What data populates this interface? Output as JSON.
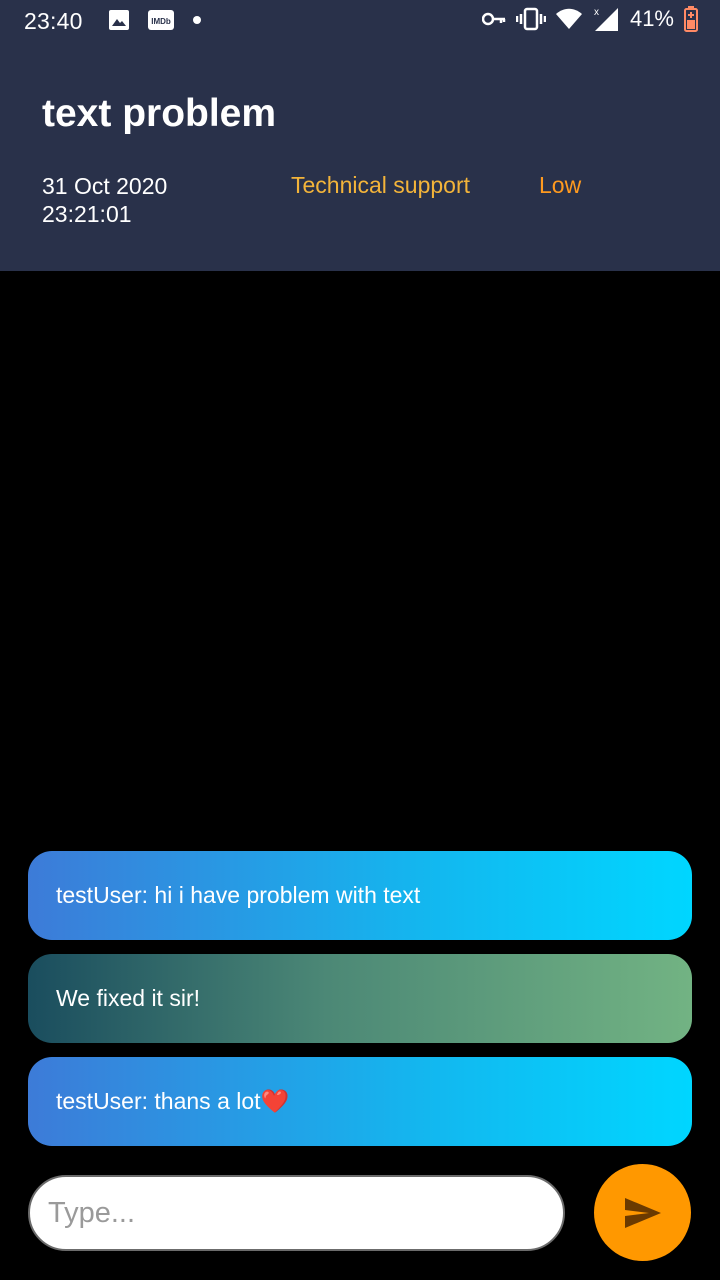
{
  "status_bar": {
    "time": "23:40",
    "left_icons": [
      "image-icon",
      "imdb-icon",
      "dot-icon"
    ],
    "imdb_label": "IMDb",
    "right_icons": [
      "key-icon",
      "vibrate-icon",
      "wifi-icon",
      "signal-icon",
      "battery-icon"
    ],
    "battery_percent": "41%"
  },
  "ticket": {
    "title": "text problem",
    "date": "31 Oct 2020",
    "time": "23:21:01",
    "category": "Technical support",
    "priority": "Low"
  },
  "messages": [
    {
      "sender": "user",
      "text": "testUser: hi i have problem with text"
    },
    {
      "sender": "support",
      "text": "We fixed it sir!"
    },
    {
      "sender": "user",
      "text": "testUser: thans a lot❤️"
    }
  ],
  "composer": {
    "placeholder": "Type...",
    "send_icon": "send-icon"
  },
  "colors": {
    "header_bg": "#29314a",
    "category": "#f3b43a",
    "priority": "#ff9a1f",
    "send_button": "#ff9800"
  }
}
